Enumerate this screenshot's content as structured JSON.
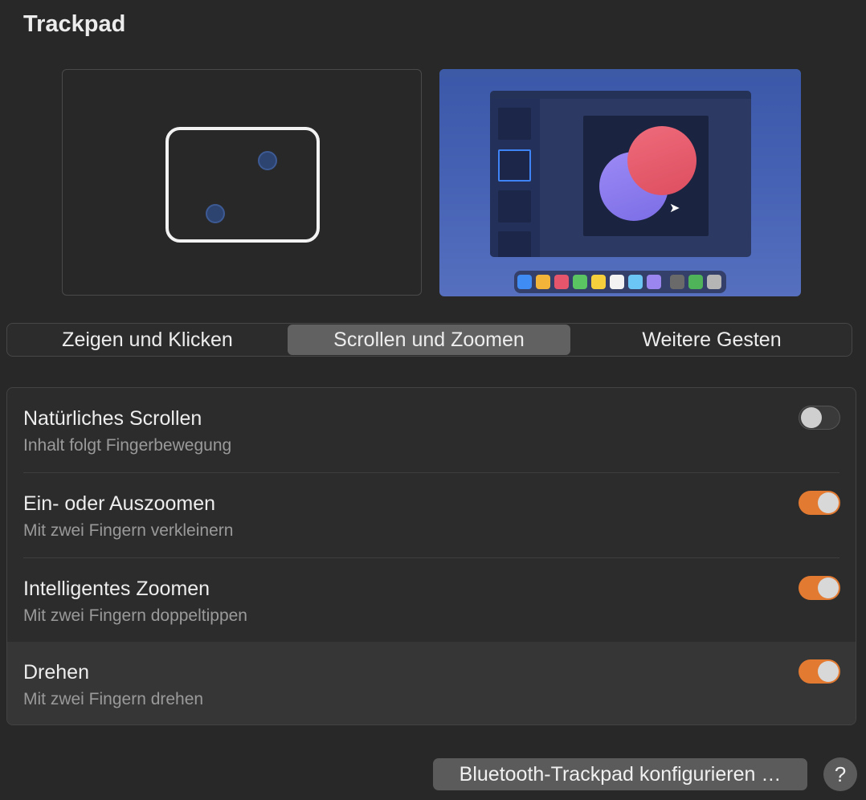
{
  "page": {
    "title": "Trackpad"
  },
  "tabs": [
    {
      "label": "Zeigen und Klicken",
      "active": false
    },
    {
      "label": "Scrollen und Zoomen",
      "active": true
    },
    {
      "label": "Weitere Gesten",
      "active": false
    }
  ],
  "settings": [
    {
      "title": "Natürliches Scrollen",
      "subtitle": "Inhalt folgt Fingerbewegung",
      "enabled": false
    },
    {
      "title": "Ein- oder Auszoomen",
      "subtitle": "Mit zwei Fingern verkleinern",
      "enabled": true
    },
    {
      "title": "Intelligentes Zoomen",
      "subtitle": "Mit zwei Fingern doppeltippen",
      "enabled": true
    },
    {
      "title": "Drehen",
      "subtitle": "Mit zwei Fingern drehen",
      "enabled": true
    }
  ],
  "footer": {
    "bluetooth_button": "Bluetooth-Trackpad konfigurieren …",
    "help_button": "?"
  },
  "colors": {
    "toggle_on": "#e27a32",
    "selected_thumb": "#3f84f6",
    "circle_red": "#e8576a",
    "circle_purple": "#8f7df0"
  }
}
